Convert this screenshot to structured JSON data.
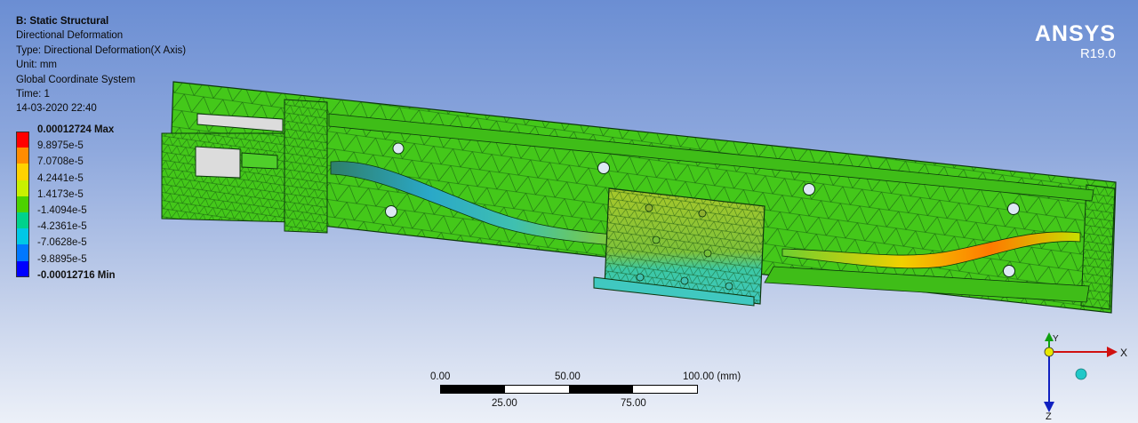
{
  "info": {
    "title": "B: Static Structural",
    "result": "Directional Deformation",
    "type": "Type: Directional Deformation(X Axis)",
    "unit": "Unit: mm",
    "system": "Global Coordinate System",
    "time": "Time: 1",
    "date": "14-03-2020 22:40"
  },
  "legend": {
    "max_label": "0.00012724 Max",
    "min_label": "-0.00012716 Min",
    "ticks": [
      "9.8975e-5",
      "7.0708e-5",
      "4.2441e-5",
      "1.4173e-5",
      "-1.4094e-5",
      "-4.2361e-5",
      "-7.0628e-5",
      "-9.8895e-5"
    ],
    "colors": [
      "#ff0000",
      "#ff8c00",
      "#ffd200",
      "#c8f000",
      "#4cd200",
      "#00d28c",
      "#00c8e6",
      "#0078ff",
      "#0000ff"
    ]
  },
  "logo": {
    "brand": "ANSYS",
    "version": "R19.0"
  },
  "scale_bar": {
    "top_labels": [
      "0.00",
      "50.00",
      "100.00 (mm)"
    ],
    "bottom_labels": [
      "25.00",
      "75.00"
    ]
  },
  "triad": {
    "x": "X",
    "y": "Y",
    "z": "Z"
  }
}
